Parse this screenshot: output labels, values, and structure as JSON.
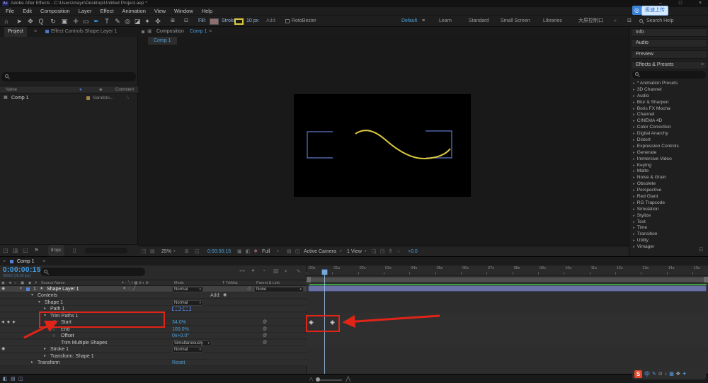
{
  "window": {
    "app_icon": "Ae",
    "title": "Adobe After Effects - C:\\Users\\mayn\\Desktop\\Untitled Project.aep *",
    "controls": {
      "minimize": "–",
      "maximize": "□",
      "close": "×"
    }
  },
  "menu": {
    "items": [
      "File",
      "Edit",
      "Composition",
      "Layer",
      "Effect",
      "Animation",
      "View",
      "Window",
      "Help"
    ]
  },
  "toolbar": {
    "tools": [
      {
        "name": "home",
        "glyph": "⌂"
      },
      {
        "name": "selection",
        "glyph": "➤"
      },
      {
        "name": "hand",
        "glyph": "✥"
      },
      {
        "name": "zoom",
        "glyph": "Q"
      },
      {
        "name": "rotate",
        "glyph": "↻"
      },
      {
        "name": "camera",
        "glyph": "▣"
      },
      {
        "name": "pan-behind",
        "glyph": "✛"
      },
      {
        "name": "shape",
        "glyph": "▭"
      },
      {
        "name": "pen",
        "glyph": "✒"
      },
      {
        "name": "type",
        "glyph": "T"
      },
      {
        "name": "brush",
        "glyph": "✎"
      },
      {
        "name": "clone-stamp",
        "glyph": "◎"
      },
      {
        "name": "eraser",
        "glyph": "◪"
      },
      {
        "name": "roto-brush",
        "glyph": "✦"
      },
      {
        "name": "puppet",
        "glyph": "✜"
      }
    ],
    "fill_label": "Fill:",
    "stroke_label": "Stroke:",
    "stroke_width": "10 px",
    "add_label": "Add:",
    "rotobezier_label": "RotoBezier",
    "workspace": {
      "active": "Default",
      "items": [
        "Learn",
        "Standard",
        "Small Screen",
        "Libraries",
        "大屏控制口"
      ],
      "overflow": "»"
    },
    "search_placeholder": "Search Help",
    "upload_badge": "极速上传"
  },
  "project": {
    "tab": "Project",
    "tab2": "Effect Controls Shape Layer 1",
    "columns": {
      "name": "Name",
      "comment": "Comment"
    },
    "row": {
      "name": "Comp 1",
      "label": "Sandsto..."
    },
    "footer": {
      "bpc": "8 bpc"
    }
  },
  "comp": {
    "tab_prefix": "Composition",
    "tab_name": "Comp 1",
    "viewer_tab": "Comp 1",
    "zoom": "25%",
    "timecode": "0:00:00:15",
    "resolution": "Full",
    "camera": "Active Camera",
    "views": "1 View",
    "exposure": "+0.0"
  },
  "right": {
    "panels": [
      "Info",
      "Audio",
      "Preview"
    ],
    "fx_title": "Effects & Presets",
    "categories": [
      "* Animation Presets",
      "3D Channel",
      "Audio",
      "Blur & Sharpen",
      "Boris FX Mocha",
      "Channel",
      "CINEMA 4D",
      "Color Correction",
      "Digital Anarchy",
      "Distort",
      "Expression Controls",
      "Generate",
      "Immersive Video",
      "Keying",
      "Matte",
      "Noise & Grain",
      "Obsolete",
      "Perspective",
      "Red Giant",
      "RG Trapcode",
      "Simulation",
      "Stylize",
      "Text",
      "Time",
      "Transition",
      "Utility",
      "Vimager"
    ]
  },
  "timeline": {
    "tab": "Comp 1",
    "timecode": "0:00:00:15",
    "timecode_sub": "00015 (25.00 fps)",
    "headers": {
      "hash": "#",
      "source_name": "Source Name",
      "switches": "✦◌╲ƒ▦⊘◐⊕",
      "mode": "Mode",
      "trkmat": "T TrkMat",
      "parent": "Parent & Link"
    },
    "layer": {
      "index": "1",
      "name": "Shape Layer 1",
      "switches": "✦◌╱",
      "mode": "Normal",
      "parent": "None"
    },
    "add_label": "Add:",
    "rows": {
      "contents": "Contents",
      "shape": "Shape 1",
      "shape_mode": "Normal",
      "path": "Path 1",
      "trim": "Trim Paths 1",
      "start": "Start",
      "start_value": "34.0%",
      "end": "End",
      "end_value": "100.0%",
      "offset": "Offset",
      "offset_value": "0x+0.0°",
      "tms": "Trim Multiple Shapes",
      "tms_value": "Simultaneously",
      "stroke": "Stroke 1",
      "stroke_mode": "Normal",
      "transform_shape": "Transform: Shape 1",
      "transform": "Transform",
      "transform_value": "Reset"
    },
    "ruler": [
      ":00s",
      "01s",
      "02s",
      "03s",
      "04s",
      "05s",
      "06s",
      "07s",
      "08s",
      "09s",
      "10s",
      "11s",
      "12s",
      "13s",
      "14s",
      "15s"
    ]
  },
  "statusbar": {
    "sogou_logo": "S",
    "sogou_icons": [
      "中",
      "✎",
      "⊙",
      "♪",
      "▦",
      "✥",
      "✦"
    ]
  },
  "colors": {
    "accent": "#4a9fd8",
    "annotation_red": "#e02418",
    "stroke_yellow": "#ddc93f",
    "render_green": "#3da43d",
    "layer_bar": "#6a70a4",
    "label_sandstone": "#a08146",
    "label_blue": "#5a7fd6"
  },
  "icons": {
    "menu": "≡",
    "caret": "▾",
    "twirl_open": "▾",
    "twirl_closed": "▸",
    "close": "×",
    "pickwhip": "@",
    "stopwatch": "◷",
    "stopwatch_off": "○",
    "eye": "◉",
    "audio": "◄",
    "solo": "○",
    "lock": "▣",
    "kf_prev": "◀",
    "kf_mid": "◆",
    "kf_next": "▶",
    "star": "★",
    "net": "∴",
    "flag": "⚑",
    "trash": "▯",
    "comp_item": "▦",
    "tag": "◆",
    "dot": "●",
    "double_chevron": "»",
    "add_dot": "◉",
    "snap1": "⊞",
    "snap2": "⊡",
    "flowchart": "⊶",
    "draft3d": "✦",
    "shy": "◔",
    "frameblend": "▧",
    "motionblur": "◐",
    "graph": "∿",
    "grid": "◫",
    "mask": "▤",
    "roi": "◱",
    "snapshot": "▣",
    "transparency": "◧",
    "channels": "❖",
    "view_opt1": "◲",
    "view_opt2": "◳",
    "view_opt3": "⊼",
    "view_opt4": "∴",
    "view_opt5": "✦",
    "folder": "◳",
    "proj1": "▥",
    "proj2": "◱",
    "mountain_small": "⋀",
    "mountain_big": "⋀",
    "tgl1": "◧",
    "tgl2": "▤",
    "tgl3": "◫",
    "panel_corner": "◱",
    "upload_logo": "◎"
  }
}
